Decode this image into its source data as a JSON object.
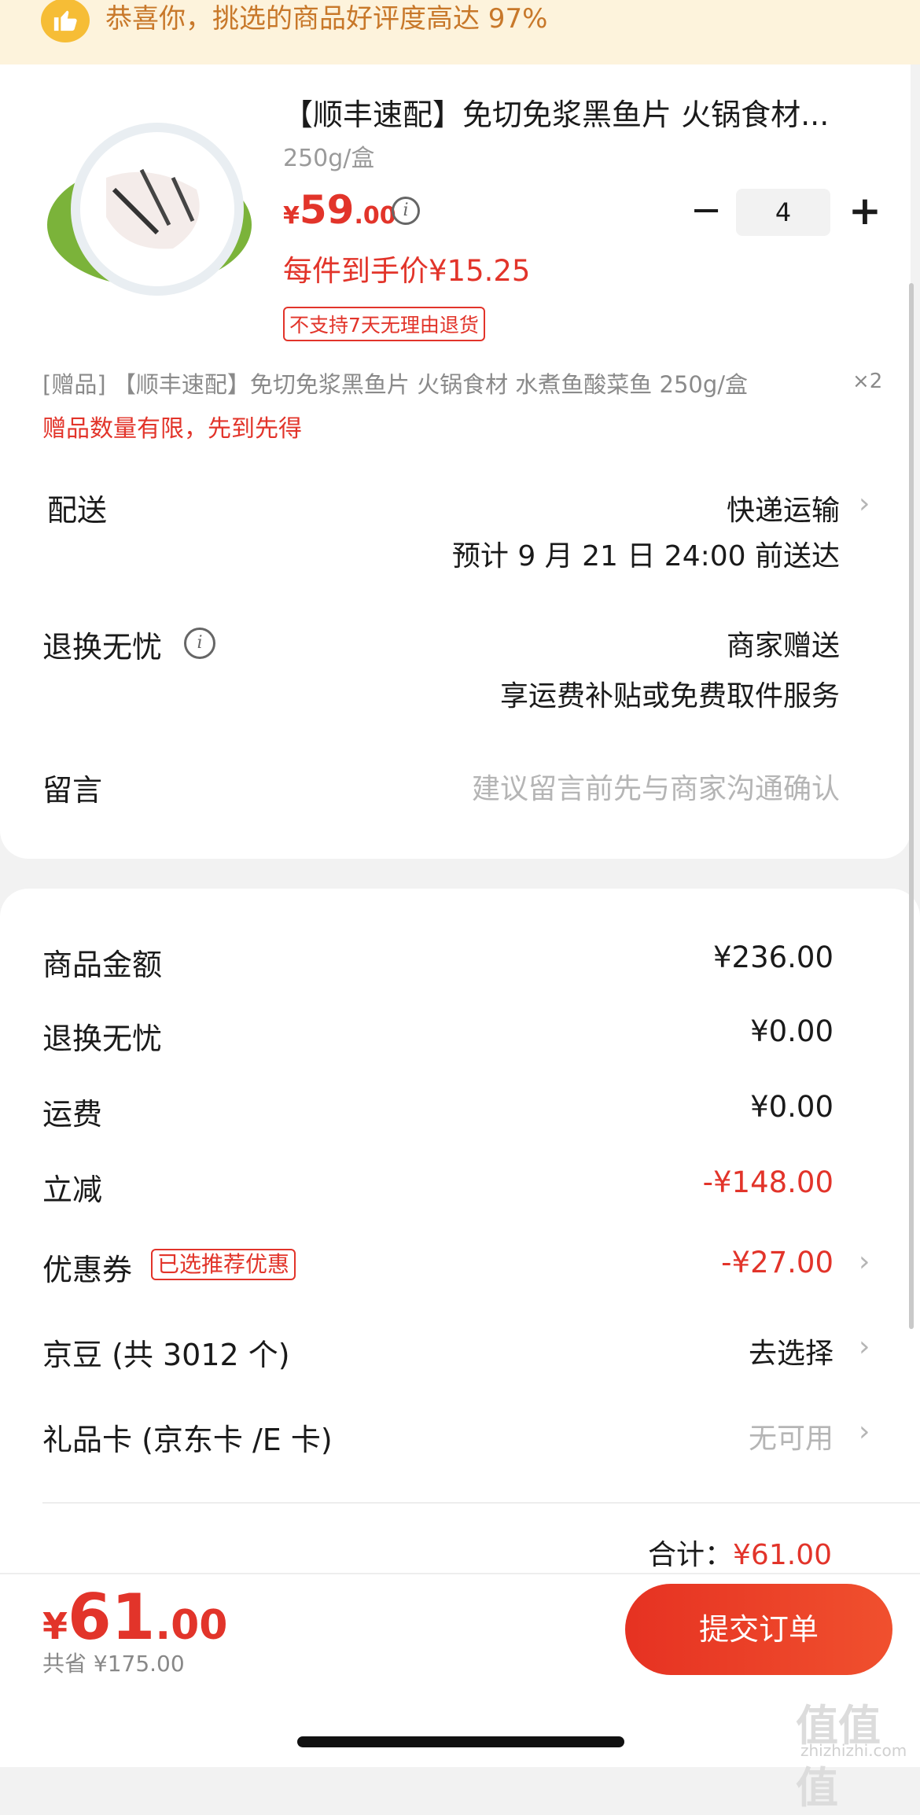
{
  "banner": {
    "text": "恭喜你，挑选的商品好评度高达 97%"
  },
  "product": {
    "title": "【顺丰速配】免切免浆黑鱼片 火锅食材...",
    "spec": "250g/盒",
    "price_currency": "¥",
    "price_int": "59",
    "price_dec": ".00",
    "unit_price": "每件到手价¥15.25",
    "return_tag": "不支持7天无理由退货",
    "quantity": "4",
    "minus": "−",
    "plus": "+"
  },
  "gift": {
    "line": "[赠品] 【顺丰速配】免切免浆黑鱼片 火锅食材 水煮鱼酸菜鱼 250g/盒",
    "qty": "×2",
    "limit": "赠品数量有限，先到先得"
  },
  "delivery": {
    "label": "配送",
    "method": "快递运输",
    "eta": "预计 9 月 21 日 24:00 前送达"
  },
  "return_worry": {
    "label": "退换无忧",
    "value": "商家赠送",
    "desc": "享运费补贴或免费取件服务"
  },
  "message": {
    "label": "留言",
    "placeholder": "建议留言前先与商家沟通确认"
  },
  "summary": {
    "goods_amount_label": "商品金额",
    "goods_amount": "¥236.00",
    "return_label": "退换无忧",
    "return_amount": "¥0.00",
    "shipping_label": "运费",
    "shipping_amount": "¥0.00",
    "discount_label": "立减",
    "discount_amount": "-¥148.00",
    "coupon_label": "优惠券",
    "coupon_tag": "已选推荐优惠",
    "coupon_amount": "-¥27.00",
    "jingdou_label": "京豆 (共 3012 个)",
    "jingdou_value": "去选择",
    "giftcard_label": "礼品卡 (京东卡 /E 卡)",
    "giftcard_value": "无可用",
    "total_label": "合计：",
    "total_amount": "¥61.00"
  },
  "bottom": {
    "currency": "¥",
    "int": "61",
    "dec": ".00",
    "saved": "共省 ¥175.00",
    "submit": "提交订单"
  },
  "watermark": {
    "main": "值值值",
    "sub": "zhizhizhi.com"
  },
  "icons": {
    "banner": "thumbs-up-icon",
    "info": "info-icon",
    "chevron": "chevron-right-icon"
  },
  "colors": {
    "accent": "#e2342a",
    "banner_bg": "#fdf3dc",
    "banner_text": "#c8782a"
  }
}
